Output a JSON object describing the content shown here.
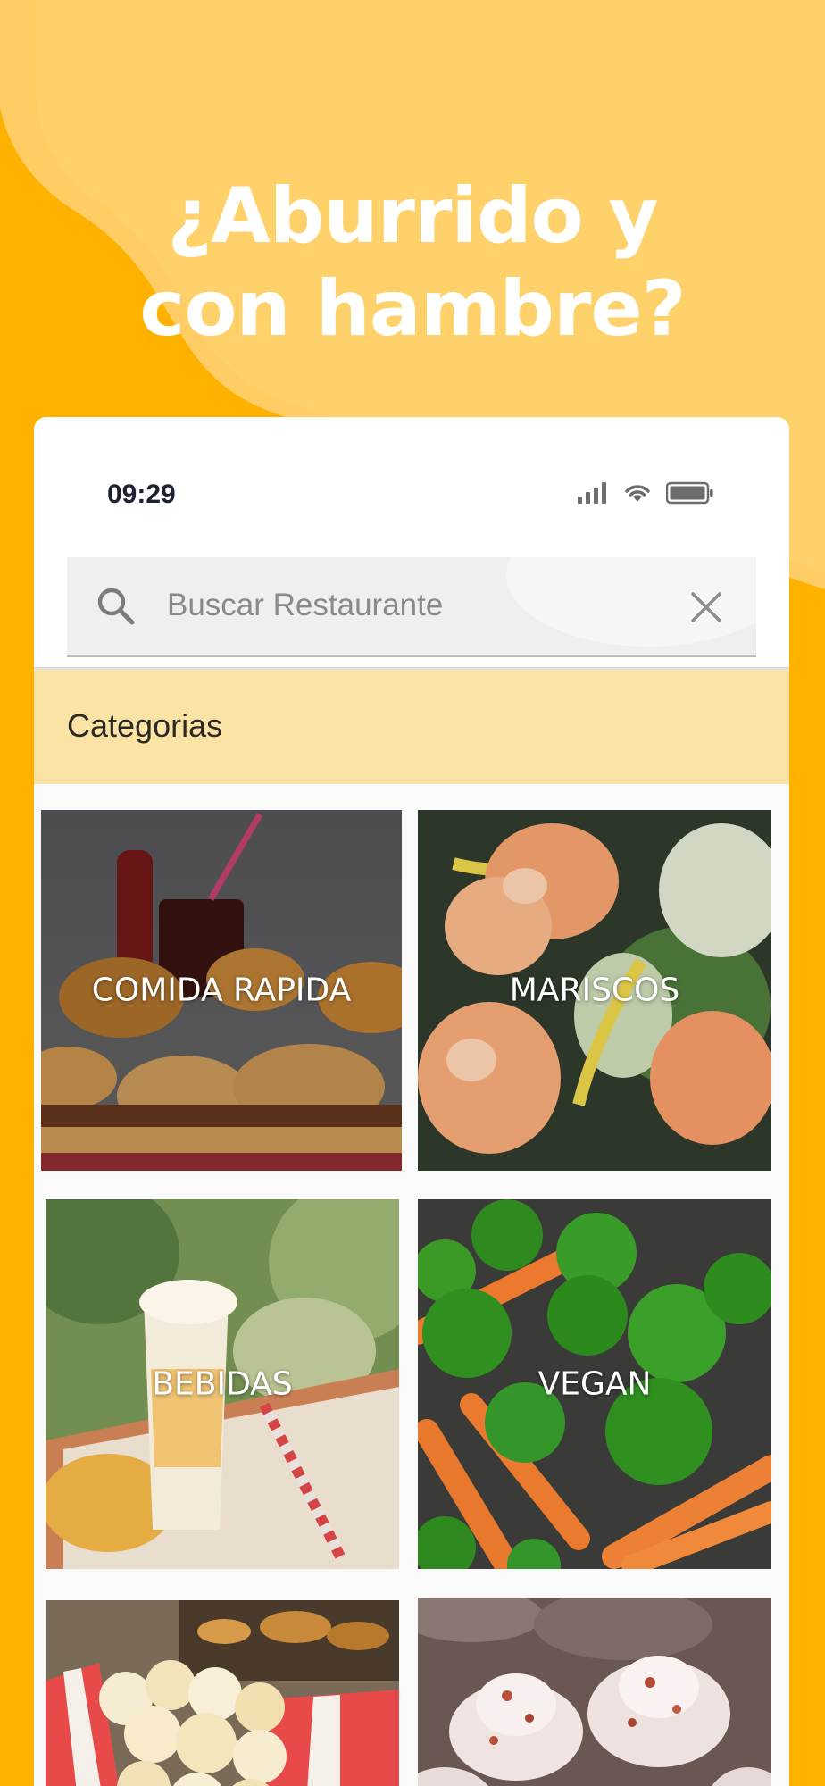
{
  "promo": {
    "headline_line1": "¿Aburrido y",
    "headline_line2": "con hambre?",
    "background_color": "#FFB100",
    "blob_color": "#FFD16A"
  },
  "status_bar": {
    "time": "09:29",
    "icons": [
      "cellular-signal-icon",
      "wifi-icon",
      "battery-icon"
    ]
  },
  "search": {
    "placeholder": "Buscar Restaurante",
    "value": "",
    "icon": "search-icon",
    "clear_icon": "close-icon"
  },
  "categories": {
    "title": "Categorias",
    "bar_color": "#FBE3A6",
    "items": [
      {
        "label": "COMIDA RAPIDA"
      },
      {
        "label": "MARISCOS"
      },
      {
        "label": "BEBIDAS"
      },
      {
        "label": "VEGAN"
      },
      {
        "label": ""
      },
      {
        "label": ""
      }
    ]
  }
}
